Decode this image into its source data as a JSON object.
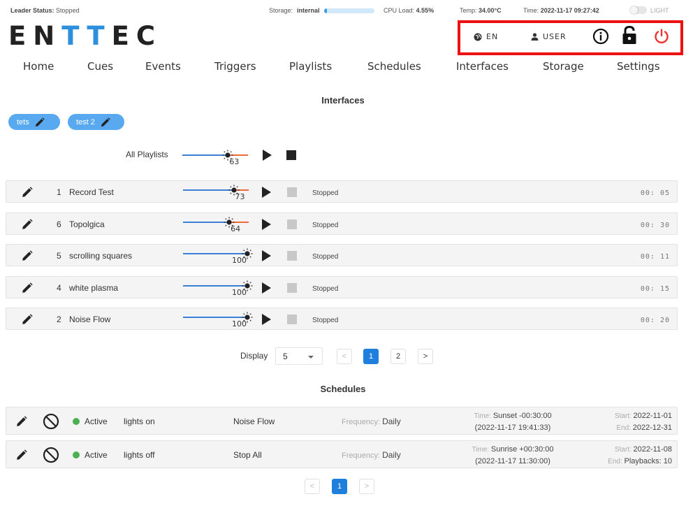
{
  "status_bar": {
    "leader_label": "Leader Status:",
    "leader_value": "Stopped",
    "storage_label": "Storage:",
    "storage_value": "internal",
    "storage_fill_fraction": 0.06,
    "cpu_label": "CPU Load:",
    "cpu_value": "4.55%",
    "temp_label": "Temp:",
    "temp_value": "34.00°C",
    "time_label": "Time:",
    "time_value": "2022-11-17 09:27:42",
    "theme_label": "LIGHT"
  },
  "logo": {
    "part1": "EN",
    "part2": "TT",
    "part3": "EC"
  },
  "utilities": {
    "language": "EN",
    "user": "USER"
  },
  "nav": [
    "Home",
    "Cues",
    "Events",
    "Triggers",
    "Playlists",
    "Schedules",
    "Interfaces",
    "Storage",
    "Settings"
  ],
  "interfaces": {
    "title": "Interfaces",
    "chips": [
      "tets",
      "test 2"
    ]
  },
  "all_playlists": {
    "label": "All Playlists",
    "level": 63
  },
  "playlists": [
    {
      "num": "1",
      "name": "Record Test",
      "level": 73,
      "status": "Stopped",
      "duration": "00: 05"
    },
    {
      "num": "6",
      "name": "Topolgica",
      "level": 64,
      "status": "Stopped",
      "duration": "00: 30"
    },
    {
      "num": "5",
      "name": "scrolling squares",
      "level": 100,
      "status": "Stopped",
      "duration": "00: 11"
    },
    {
      "num": "4",
      "name": "white plasma",
      "level": 100,
      "status": "Stopped",
      "duration": "00: 15"
    },
    {
      "num": "2",
      "name": "Noise Flow",
      "level": 100,
      "status": "Stopped",
      "duration": "00: 20"
    }
  ],
  "playlist_pagination": {
    "display_label": "Display",
    "display_value": "5",
    "prev": "<",
    "pages": [
      "1",
      "2"
    ],
    "next": ">"
  },
  "schedules": {
    "title": "Schedules",
    "rows": [
      {
        "state": "Active",
        "name": "lights on",
        "target": "Noise Flow",
        "freq_label": "Frequency:",
        "freq_value": "Daily",
        "time_label": "Time:",
        "time_value": "Sunset -00:30:00",
        "time_sub": "(2022-11-17 19:41:33)",
        "start_label": "Start:",
        "start_value": "2022-11-01",
        "end_label": "End:",
        "end_value": "2022-12-31"
      },
      {
        "state": "Active",
        "name": "lights off",
        "target": "Stop All",
        "freq_label": "Frequency:",
        "freq_value": "Daily",
        "time_label": "Time:",
        "time_value": "Sunrise +00:30:00",
        "time_sub": "(2022-11-17 11:30:00)",
        "start_label": "Start:",
        "start_value": "2022-11-08",
        "end_label": "End:",
        "end_value": "Playbacks: 10"
      }
    ]
  },
  "schedule_pagination": {
    "prev": "<",
    "page": "1",
    "next": ">"
  },
  "colors": {
    "accent": "#2e8fdd",
    "chip": "#58a9f0",
    "active_page": "#1f7fdc",
    "power": "#ee3333",
    "highlight_box": "#ee1111",
    "active_dot": "#4caf50"
  }
}
